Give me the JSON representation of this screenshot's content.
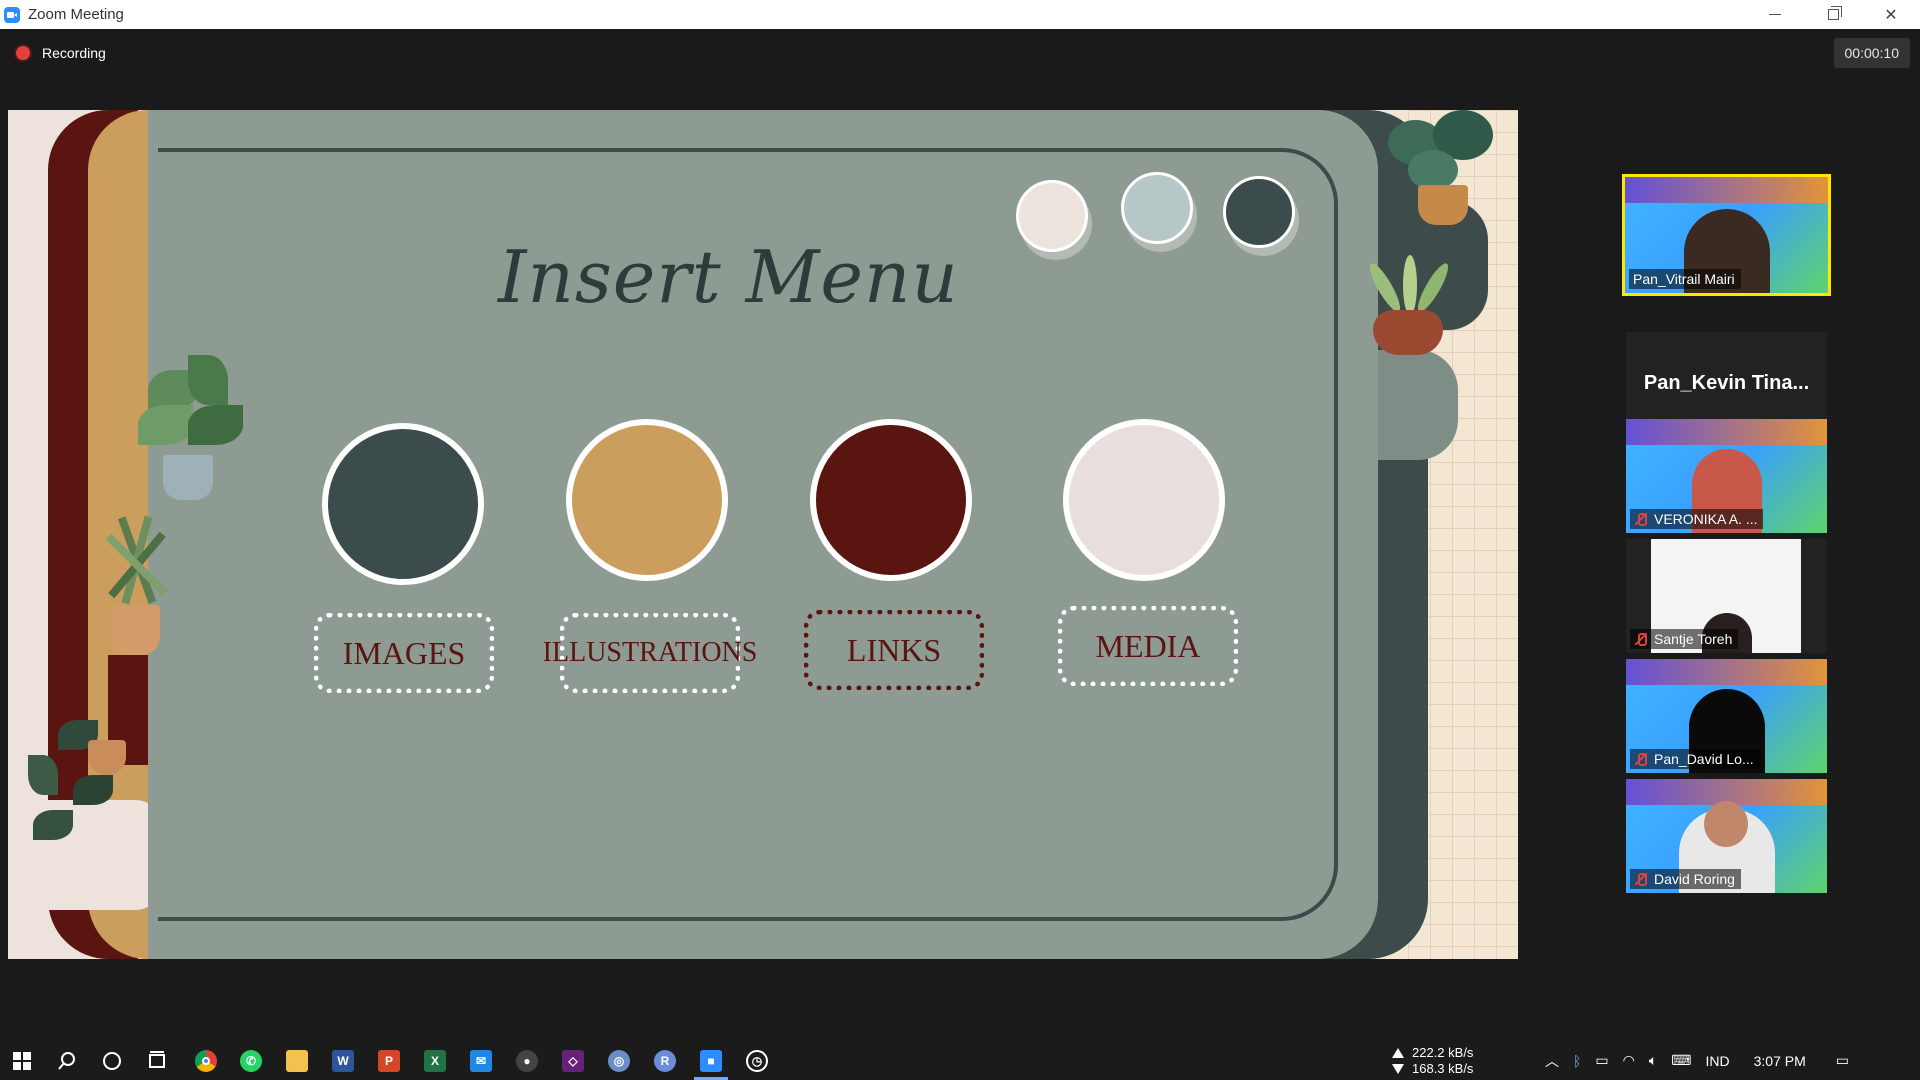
{
  "window": {
    "title": "Zoom Meeting"
  },
  "meeting": {
    "recording_label": "Recording",
    "timer": "00:00:10"
  },
  "slide": {
    "title": "Insert Menu",
    "palette_dots": [
      "#ede3dd",
      "#b7c7c7",
      "#3c4b4b"
    ],
    "menu": [
      {
        "label": "IMAGES",
        "circle_color": "#3c4b4b",
        "label_color": "#5a1510",
        "border_color": "#ffffff"
      },
      {
        "label": "ILLUSTRATIONS",
        "circle_color": "#cc9e5e",
        "label_color": "#5a1510",
        "border_color": "#ffffff"
      },
      {
        "label": "LINKS",
        "circle_color": "#5a1510",
        "label_color": "#5a1510",
        "border_color": "#5a1510"
      },
      {
        "label": "MEDIA",
        "circle_color": "#e8dfdc",
        "label_color": "#5a1510",
        "border_color": "#ffffff"
      }
    ]
  },
  "participants": [
    {
      "name": "Pan_Vitrail Mairi",
      "muted": false,
      "active": true,
      "type": "video"
    },
    {
      "name": "Pan_Kevin  Tina...",
      "muted": true,
      "active": false,
      "type": "name_only"
    },
    {
      "name": "VERONIKA A. ...",
      "muted": true,
      "active": false,
      "type": "video"
    },
    {
      "name": "Santje Toreh",
      "muted": true,
      "active": false,
      "type": "video_white"
    },
    {
      "name": "Pan_David Lo...",
      "muted": true,
      "active": false,
      "type": "video"
    },
    {
      "name": "David Roring",
      "muted": true,
      "active": false,
      "type": "video"
    }
  ],
  "taskbar": {
    "upload_speed": "222.2 kB/s",
    "download_speed": "168.3 kB/s",
    "language": "IND",
    "clock": "3:07 PM",
    "icons": [
      "windows-start-icon",
      "search-icon",
      "cortana-icon",
      "task-view-icon",
      "chrome-icon",
      "whatsapp-icon",
      "file-explorer-icon",
      "word-icon",
      "powerpoint-icon",
      "excel-icon",
      "mail-icon",
      "obs-icon",
      "visual-studio-icon",
      "browser-icon",
      "r-icon",
      "zoom-icon",
      "clock-app-icon"
    ]
  }
}
